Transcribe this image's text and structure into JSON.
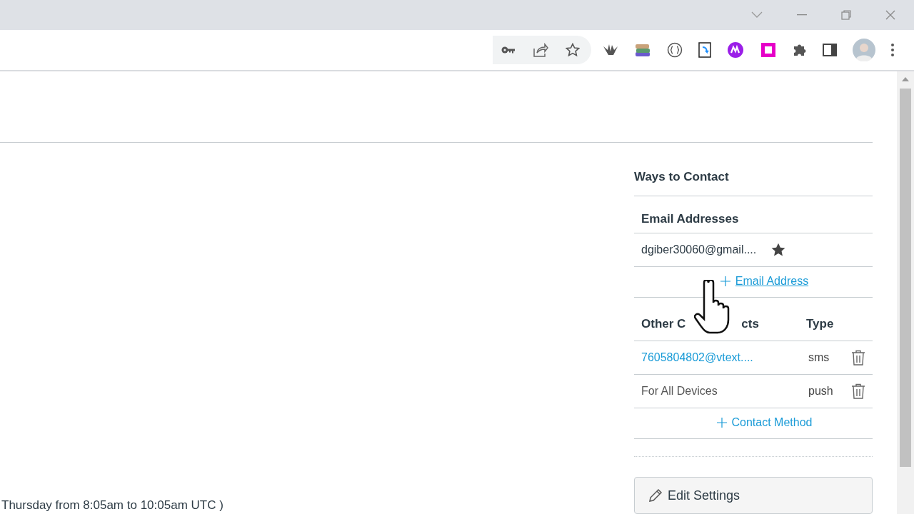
{
  "contact_panel": {
    "title": "Ways to Contact",
    "email_section": {
      "heading": "Email Addresses",
      "emails": [
        {
          "address": "dgiber30060@gmail....",
          "default": true
        }
      ],
      "add_link": "Email Address"
    },
    "other_contacts": {
      "heading_parts": [
        "Other C",
        "cts"
      ],
      "type_heading": "Type",
      "rows": [
        {
          "name": "7605804802@vtext....",
          "type": "sms",
          "kind": "link"
        },
        {
          "name": "For All Devices",
          "type": "push",
          "kind": "plain"
        }
      ],
      "add_link": "Contact Method"
    },
    "edit_button": "Edit Settings"
  },
  "footer_text": "Thursday from 8:05am to 10:05am UTC )"
}
